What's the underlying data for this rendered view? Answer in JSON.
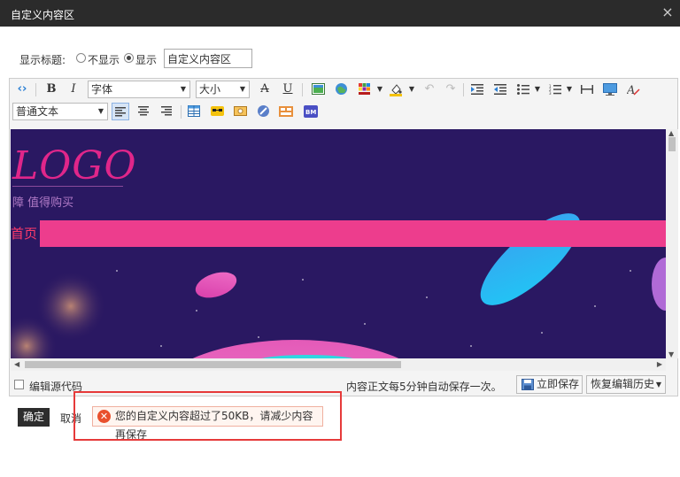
{
  "dialog": {
    "title": "自定义内容区",
    "close_glyph": "×"
  },
  "title_setting": {
    "label": "显示标题:",
    "options": [
      {
        "label": "不显示",
        "selected": false
      },
      {
        "label": "显示",
        "selected": true
      }
    ],
    "value": "自定义内容区"
  },
  "toolbar": {
    "font_family": "字体",
    "font_size": "大小",
    "paragraph_format": "普通文本",
    "icons": [
      "source-icon",
      "bold-icon",
      "italic-icon",
      "strikethrough-icon",
      "underline-icon",
      "image-icon",
      "map-icon",
      "text-color-icon",
      "background-color-icon",
      "undo-icon",
      "redo-icon",
      "indent-icon",
      "outdent-icon",
      "bullet-list-icon",
      "numbered-list-icon",
      "horizontal-rule-icon",
      "media-icon",
      "clear-format-icon",
      "align-left-icon",
      "align-center-icon",
      "align-right-icon",
      "table-icon",
      "emoticon-icon",
      "flash-icon",
      "link-icon",
      "template-icon",
      "bm-icon"
    ]
  },
  "content_preview": {
    "logo_text": "LOGO",
    "slogan": "障 值得购买",
    "nav_home": "首页",
    "colors": {
      "background": "#2c1865",
      "nav_bar": "#ed3d8d",
      "logo": "#e0268a"
    }
  },
  "footer": {
    "source_toggle_label": "编辑源代码",
    "autosave_note": "内容正文每5分钟自动保存一次。",
    "save_now_label": "立即保存",
    "restore_label": "恢复编辑历史"
  },
  "actions": {
    "confirm_label": "确定",
    "cancel_label": "取消"
  },
  "error": {
    "message": "您的自定义内容超过了50KB，请减少内容再保存",
    "color": "#e9502d"
  }
}
